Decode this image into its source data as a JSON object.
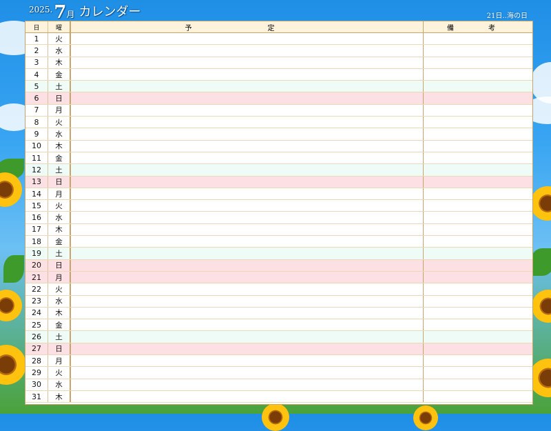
{
  "header": {
    "year": "2025.",
    "month": "7",
    "month_unit": "月",
    "title": "カレンダー",
    "holiday_note": "21日‥海の日"
  },
  "columns": {
    "day": "日",
    "weekday": "曜",
    "plan": "予　定",
    "note": "備　考"
  },
  "days": [
    {
      "d": "1",
      "w": "火",
      "type": "weekday"
    },
    {
      "d": "2",
      "w": "水",
      "type": "weekday"
    },
    {
      "d": "3",
      "w": "木",
      "type": "weekday"
    },
    {
      "d": "4",
      "w": "金",
      "type": "weekday"
    },
    {
      "d": "5",
      "w": "土",
      "type": "sat"
    },
    {
      "d": "6",
      "w": "日",
      "type": "sun"
    },
    {
      "d": "7",
      "w": "月",
      "type": "weekday"
    },
    {
      "d": "8",
      "w": "火",
      "type": "weekday"
    },
    {
      "d": "9",
      "w": "水",
      "type": "weekday"
    },
    {
      "d": "10",
      "w": "木",
      "type": "weekday"
    },
    {
      "d": "11",
      "w": "金",
      "type": "weekday"
    },
    {
      "d": "12",
      "w": "土",
      "type": "sat"
    },
    {
      "d": "13",
      "w": "日",
      "type": "sun"
    },
    {
      "d": "14",
      "w": "月",
      "type": "weekday"
    },
    {
      "d": "15",
      "w": "火",
      "type": "weekday"
    },
    {
      "d": "16",
      "w": "水",
      "type": "weekday"
    },
    {
      "d": "17",
      "w": "木",
      "type": "weekday"
    },
    {
      "d": "18",
      "w": "金",
      "type": "weekday"
    },
    {
      "d": "19",
      "w": "土",
      "type": "sat"
    },
    {
      "d": "20",
      "w": "日",
      "type": "sun"
    },
    {
      "d": "21",
      "w": "月",
      "type": "sun"
    },
    {
      "d": "22",
      "w": "火",
      "type": "weekday"
    },
    {
      "d": "23",
      "w": "水",
      "type": "weekday"
    },
    {
      "d": "24",
      "w": "木",
      "type": "weekday"
    },
    {
      "d": "25",
      "w": "金",
      "type": "weekday"
    },
    {
      "d": "26",
      "w": "土",
      "type": "sat"
    },
    {
      "d": "27",
      "w": "日",
      "type": "sun"
    },
    {
      "d": "28",
      "w": "月",
      "type": "weekday"
    },
    {
      "d": "29",
      "w": "火",
      "type": "weekday"
    },
    {
      "d": "30",
      "w": "水",
      "type": "weekday"
    },
    {
      "d": "31",
      "w": "木",
      "type": "weekday"
    }
  ],
  "colors": {
    "sky": "#1f8fe6",
    "saturday_row": "#eefbf6",
    "sunday_holiday_row": "#fde0e4",
    "border": "#c9a46a",
    "header_row": "#fdf3dc"
  },
  "background_icons": [
    "cloud-icon",
    "sunflower-icon"
  ]
}
